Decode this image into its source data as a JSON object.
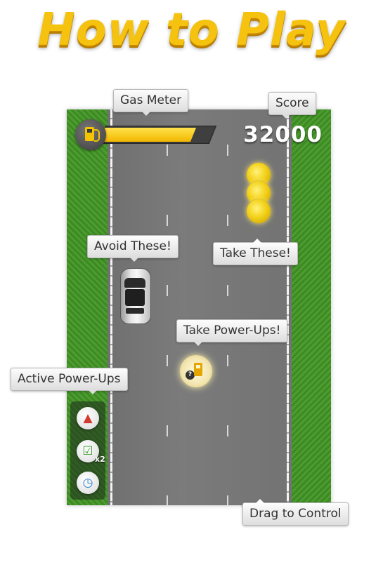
{
  "title": "How to Play",
  "hud": {
    "score": "32000",
    "gas_level": 0.82
  },
  "callouts": {
    "gas_meter": "Gas Meter",
    "score": "Score",
    "avoid": "Avoid These!",
    "take": "Take These!",
    "powerups": "Take Power-Ups!",
    "active_powerups": "Active Power-Ups",
    "drag": "Drag to Control"
  },
  "active_powerups": [
    {
      "icon": "rocket-icon"
    },
    {
      "icon": "checkbox-icon",
      "multiplier": "x2"
    },
    {
      "icon": "clock-icon"
    }
  ],
  "colors": {
    "title_gold": "#f4c20f",
    "grass": "#449129",
    "road": "#757575",
    "gas_fill": "#f2b700"
  }
}
